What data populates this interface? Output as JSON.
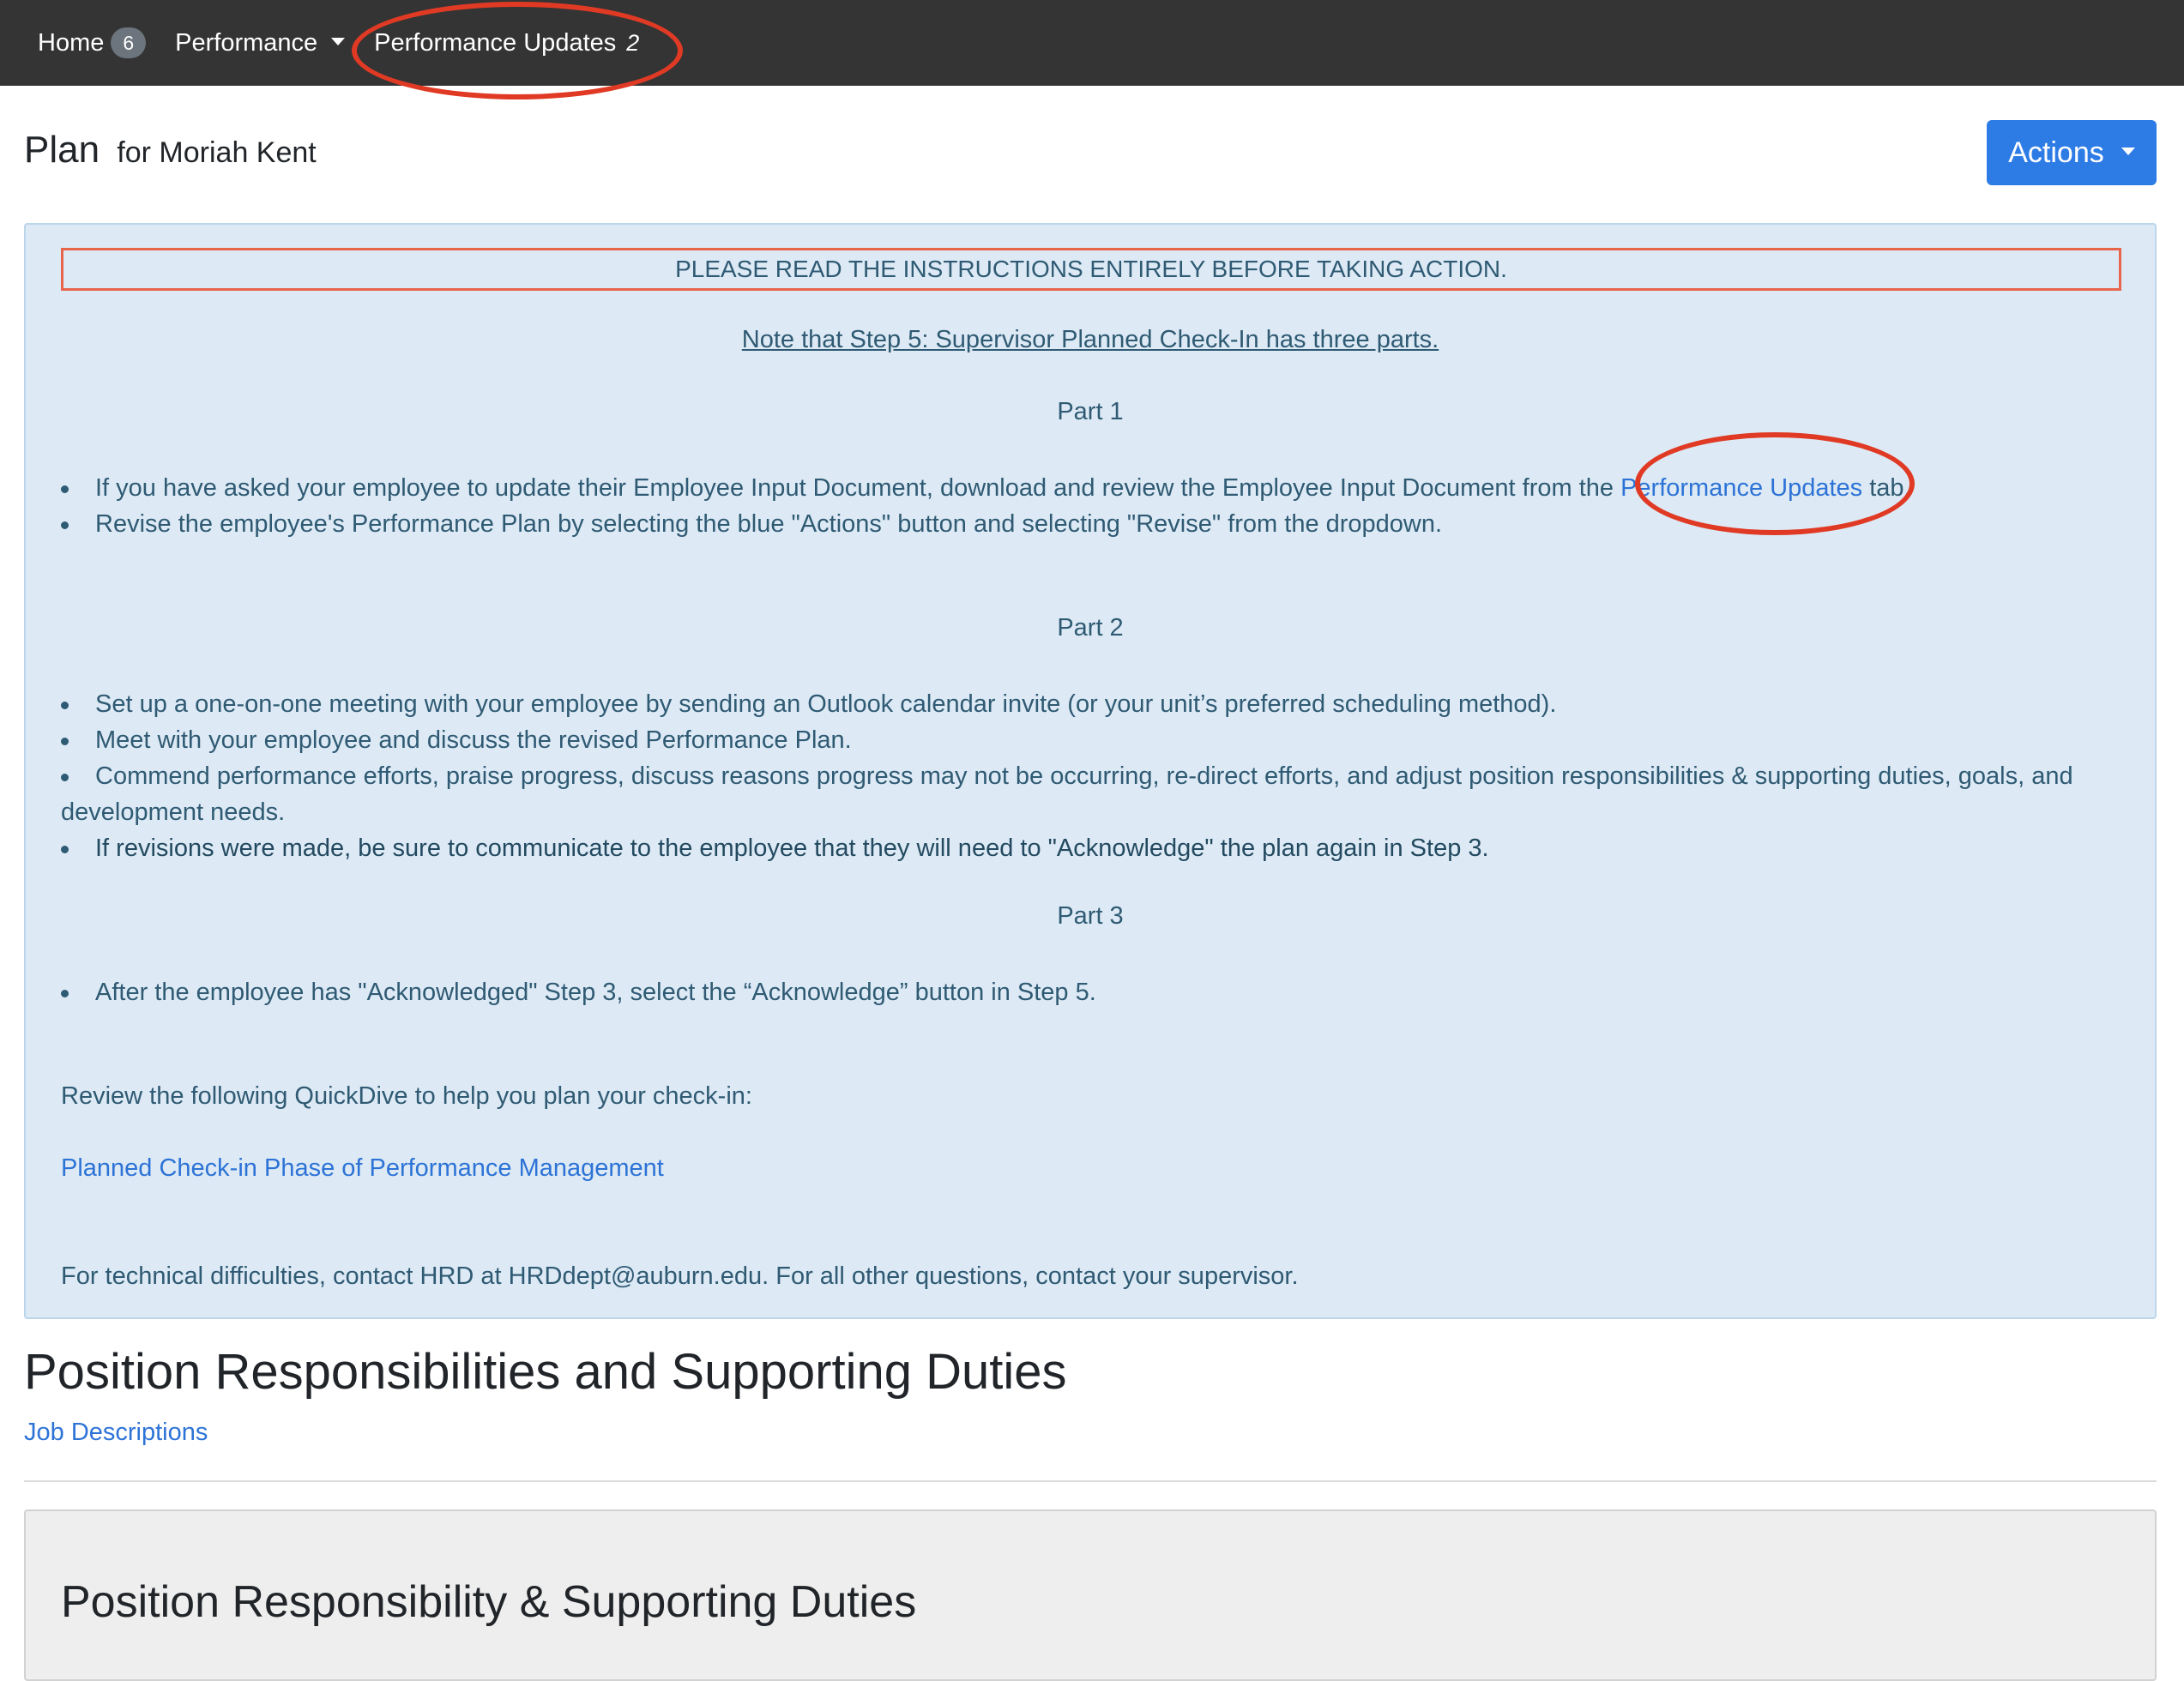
{
  "nav": {
    "home_label": "Home",
    "home_badge": "6",
    "performance_label": "Performance",
    "updates_label": "Performance Updates",
    "updates_count": "2"
  },
  "header": {
    "title": "Plan",
    "subtitle": "for Moriah Kent",
    "actions_label": "Actions"
  },
  "instructions": {
    "warning": "PLEASE READ THE INSTRUCTIONS ENTIRELY BEFORE TAKING ACTION.",
    "note": "Note that Step 5: Supervisor Planned Check-In has three parts.",
    "part1": {
      "heading": "Part 1",
      "bullet1_before": "If you have asked your employee to update their Employee Input Document, download and review the Employee Input Document from the ",
      "bullet1_link": "Performance Updates",
      "bullet1_after": " tab.",
      "bullet2": "Revise the employee's Performance Plan by selecting the blue \"Actions\" button and selecting \"Revise\" from the dropdown."
    },
    "part2": {
      "heading": "Part 2",
      "bullet1": "Set up a one-on-one meeting with your employee by sending an Outlook calendar invite (or your unit’s preferred scheduling method).",
      "bullet2": "Meet with your employee and discuss the revised Performance Plan.",
      "bullet3_line1": "Commend performance efforts, praise progress, discuss reasons progress may not be occurring, re-direct efforts, and adjust position responsibilities & supporting duties, goals, and",
      "bullet3_line2": "development needs.",
      "bullet4": "If revisions were made, be sure to communicate to the employee that they will need to \"Acknowledge\" the plan again in Step 3."
    },
    "part3": {
      "heading": "Part 3",
      "bullet1": "After the employee has \"Acknowledged\" Step 3, select the “Acknowledge” button in Step 5."
    },
    "review_text": "Review the following QuickDive to help you plan your check-in:",
    "quickdive_link": "Planned Check-in Phase of Performance Management",
    "contact_text": "For technical difficulties, contact HRD at HRDdept@auburn.edu. For all other questions, contact your supervisor."
  },
  "section": {
    "heading": "Position Responsibilities and Supporting Duties",
    "job_link": "Job Descriptions",
    "card_title": "Position Responsibility & Supporting Duties"
  },
  "colors": {
    "navbar_bg": "#343434",
    "primary_blue": "#2d7ce6",
    "info_bg": "#ddeaf5",
    "annotation_red": "#e03a25"
  }
}
